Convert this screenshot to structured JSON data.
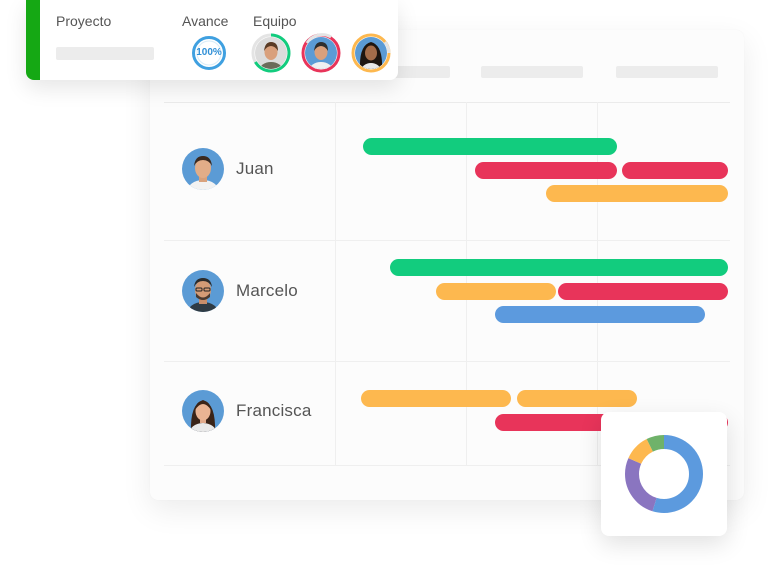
{
  "project_card": {
    "col_project": "Proyecto",
    "col_progress": "Avance",
    "col_team": "Equipo",
    "progress_text": "100%",
    "accent_color": "#15a814"
  },
  "rows": [
    {
      "name": "Juan"
    },
    {
      "name": "Marcelo"
    },
    {
      "name": "Francisca"
    }
  ],
  "colors": {
    "green": "#12cc7e",
    "red": "#e8345a",
    "orange": "#fdb84f",
    "blue": "#5c9ade"
  }
}
